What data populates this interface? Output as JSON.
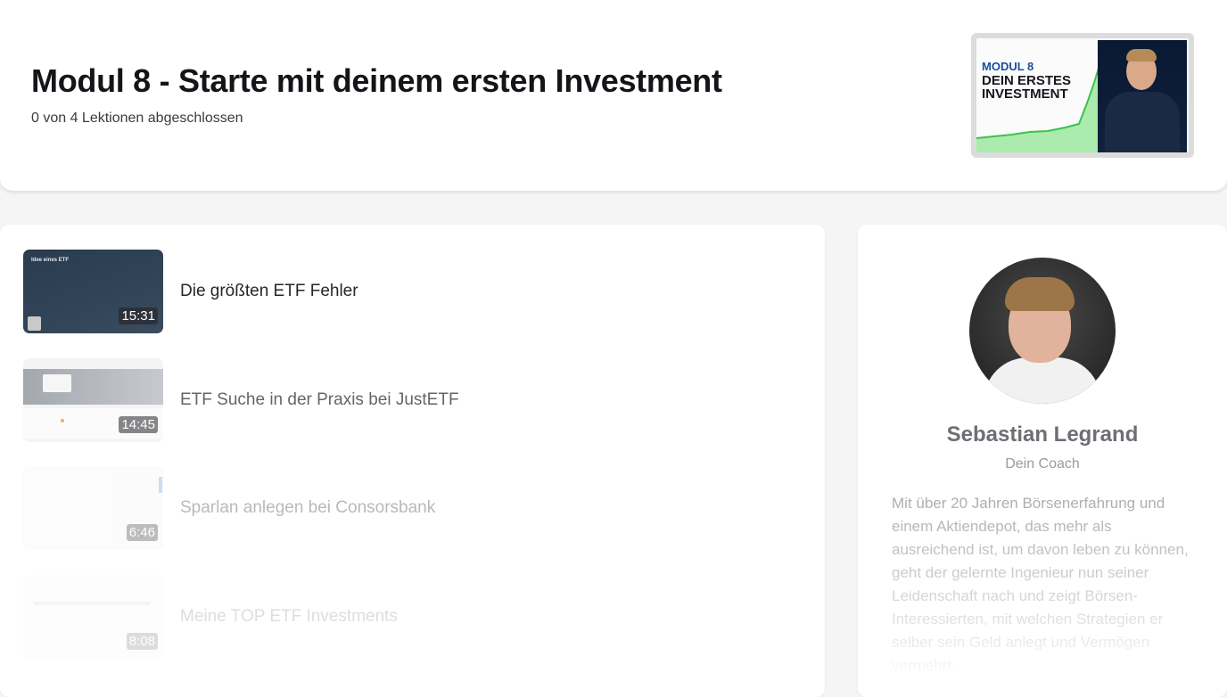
{
  "header": {
    "title": "Modul 8 - Starte mit deinem ersten Investment",
    "progress": "0 von 4 Lektionen abgeschlossen",
    "thumbnail": {
      "tag": "MODUL 8",
      "headline": "DEIN ERSTES INVESTMENT"
    }
  },
  "lessons": [
    {
      "title": "Die größten ETF Fehler",
      "duration": "15:31",
      "thumb_label": "Idee eines ETF"
    },
    {
      "title": "ETF Suche in der Praxis bei JustETF",
      "duration": "14:45"
    },
    {
      "title": "Sparlan anlegen bei Consorsbank",
      "duration": "6:46"
    },
    {
      "title": "Meine TOP ETF Investments",
      "duration": "8:08"
    }
  ],
  "coach": {
    "name": "Sebastian Legrand",
    "role": "Dein Coach",
    "bio": "Mit über 20 Jahren Börsenerfahrung und einem Aktiendepot, das mehr als ausreichend ist, um davon leben zu können, geht der gelernte Ingenieur nun seiner Leidenschaft nach und zeigt Börsen-Interessierten, mit welchen Strategien er selber sein Geld anlegt und Vermögen vermehrt."
  }
}
